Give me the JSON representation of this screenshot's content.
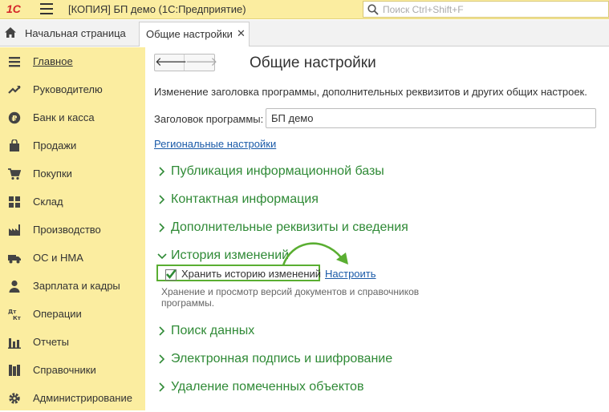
{
  "app": {
    "logo": "1С",
    "title": "[КОПИЯ] БП демо  (1С:Предприятие)",
    "search_placeholder": "Поиск Ctrl+Shift+F"
  },
  "tabs": {
    "home_label": "Начальная страница",
    "active_label": "Общие настройки",
    "close": "✕"
  },
  "sidebar": {
    "items": [
      {
        "label": "Главное",
        "icon": "menu-lines-icon"
      },
      {
        "label": "Руководителю",
        "icon": "trend-chart-icon"
      },
      {
        "label": "Банк и касса",
        "icon": "ruble-coin-icon"
      },
      {
        "label": "Продажи",
        "icon": "shopping-bag-icon"
      },
      {
        "label": "Покупки",
        "icon": "cart-icon"
      },
      {
        "label": "Склад",
        "icon": "warehouse-grid-icon"
      },
      {
        "label": "Производство",
        "icon": "factory-icon"
      },
      {
        "label": "ОС и НМА",
        "icon": "truck-icon"
      },
      {
        "label": "Зарплата и кадры",
        "icon": "person-icon"
      },
      {
        "label": "Операции",
        "icon": "debit-credit-icon"
      },
      {
        "label": "Отчеты",
        "icon": "bar-chart-icon"
      },
      {
        "label": "Справочники",
        "icon": "books-icon"
      },
      {
        "label": "Администрирование",
        "icon": "gear-icon"
      }
    ]
  },
  "main": {
    "nav_back": "🡐",
    "nav_forward": "🡒",
    "title": "Общие настройки",
    "description": "Изменение заголовка программы, дополнительных реквизитов и других общих настроек.",
    "program_title_label": "Заголовок программы:",
    "program_title_value": "БП демо",
    "regional_link": "Региональные настройки",
    "sections": [
      {
        "title": "Публикация информационной базы",
        "expanded": false
      },
      {
        "title": "Контактная информация",
        "expanded": false
      },
      {
        "title": "Дополнительные реквизиты и сведения",
        "expanded": false
      },
      {
        "title": "История изменений",
        "expanded": true
      },
      {
        "title": "Поиск данных",
        "expanded": false
      },
      {
        "title": "Электронная подпись и шифрование",
        "expanded": false
      },
      {
        "title": "Удаление помеченных объектов",
        "expanded": false
      }
    ],
    "history": {
      "checkbox_label": "Хранить историю изменений",
      "checked": true,
      "configure_link": "Настроить",
      "hint": "Хранение и просмотр версий документов и справочников программы."
    }
  },
  "colors": {
    "sidebar_bg": "#fbeda0",
    "section_green": "#2f8a36",
    "highlight_green": "#5aae32",
    "link_blue": "#1a5aa8",
    "logo_red": "#d4262a"
  }
}
